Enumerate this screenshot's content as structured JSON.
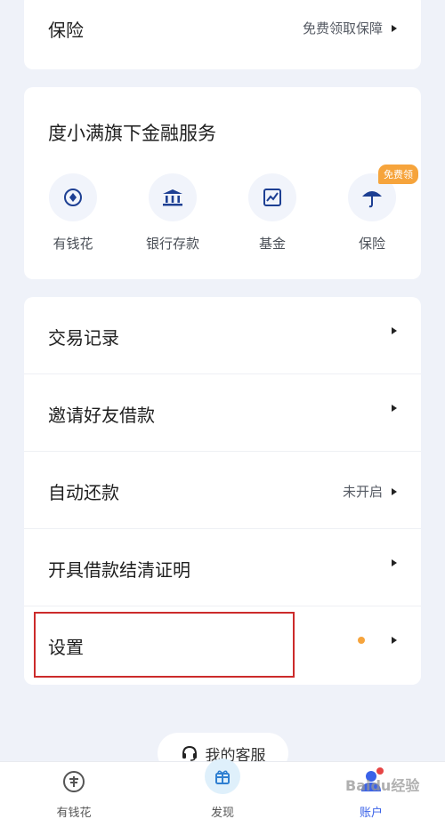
{
  "insurance": {
    "title": "保险",
    "subtitle": "免费领取保障"
  },
  "services": {
    "title": "度小满旗下金融服务",
    "items": [
      {
        "label": "有钱花",
        "icon": "diamond-coin-icon"
      },
      {
        "label": "银行存款",
        "icon": "bank-icon"
      },
      {
        "label": "基金",
        "icon": "fund-chart-icon"
      },
      {
        "label": "保险",
        "icon": "umbrella-icon",
        "badge": "免费领"
      }
    ]
  },
  "menu": {
    "items": [
      {
        "label": "交易记录",
        "value": ""
      },
      {
        "label": "邀请好友借款",
        "value": ""
      },
      {
        "label": "自动还款",
        "value": "未开启"
      },
      {
        "label": "开具借款结清证明",
        "value": ""
      },
      {
        "label": "设置",
        "value": ""
      }
    ]
  },
  "customer_service": {
    "label": "我的客服"
  },
  "bottom_nav": {
    "items": [
      {
        "label": "有钱花",
        "icon": "coin-icon"
      },
      {
        "label": "发现",
        "icon": "gift-icon"
      },
      {
        "label": "账户",
        "icon": "user-icon"
      }
    ]
  },
  "watermark": "Baidu经验",
  "colors": {
    "accent": "#3a62e8",
    "badge": "#f6a43c",
    "highlight": "#cc2b2b",
    "background": "#eff2f9"
  }
}
